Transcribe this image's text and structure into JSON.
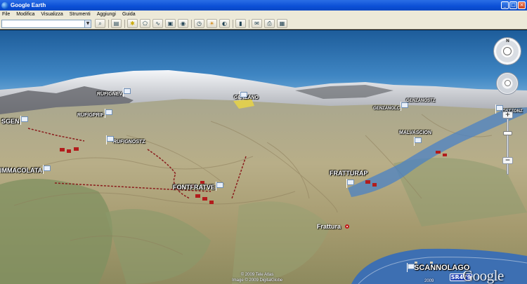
{
  "window": {
    "title": "Google Earth"
  },
  "menu": [
    "File",
    "Modifica",
    "Visualizza",
    "Strumenti",
    "Aggiungi",
    "Guida"
  ],
  "search": {
    "value": ""
  },
  "toolbar_icons": [
    "search-icon",
    "sidebar-toggle-icon",
    "placemark-icon",
    "polygon-icon",
    "path-icon",
    "image-overlay-icon",
    "record-tour-icon",
    "historical-imagery-icon",
    "sunlight-icon",
    "planets-icon",
    "ruler-icon",
    "email-icon",
    "print-icon",
    "google-maps-icon"
  ],
  "placemarks": {
    "rufignev": "RUFIGNEV",
    "genzano": "GENZANO",
    "sgen": "SGEN",
    "rufigprif": "RUFIGPRIF",
    "rufignostz": "RUFIGNOSTZ",
    "immacolata": "IMMACOLATA",
    "fontfratve": "FONTFRATVE",
    "fratturap": "FRATTURAP",
    "malvascion": "MALVASCION",
    "genzanolc": "GENZANOLC",
    "genzanostz": "GENZANOSTZ",
    "scannolago": "SCANNOLAGO",
    "ostzonz": "OSTZONZ"
  },
  "town": "Frattura",
  "road_shield": "SR479",
  "copyright": {
    "line1": "© 2009 Tele Atlas",
    "line2": "Image © 2009 DigitalGlobe",
    "year": "2009"
  },
  "logo": "Google",
  "nav": {
    "north": "N",
    "zoom_in": "+",
    "zoom_out": "−"
  },
  "colors": {
    "titlebar": "#0b4fd6",
    "chrome": "#ece9d8",
    "flag": "#e9f0fa",
    "road": "#8a1c1c",
    "lake": "#3d6fb2"
  }
}
